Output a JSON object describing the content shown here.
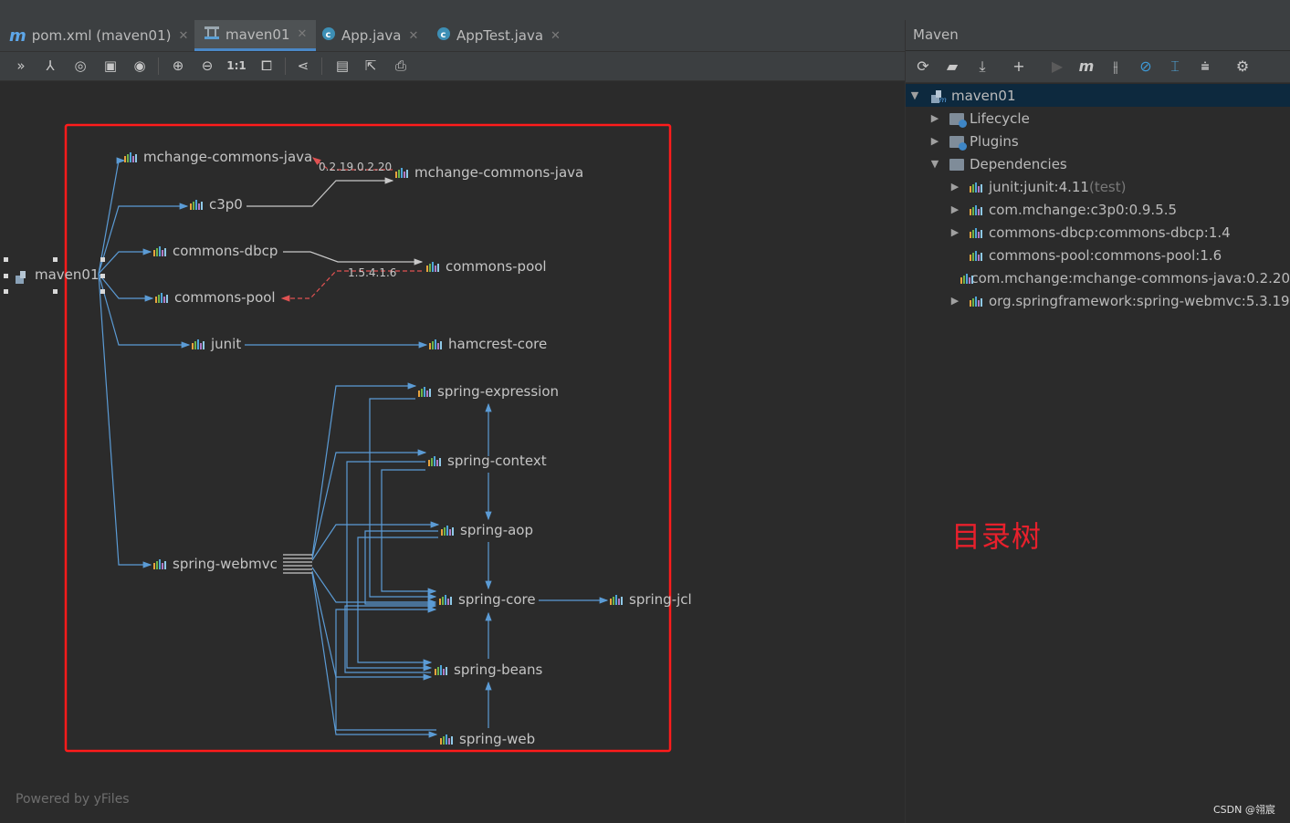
{
  "editor": {
    "tabs": [
      {
        "icon": "m",
        "label": "pom.xml (maven01)",
        "active": false
      },
      {
        "icon": "diagram",
        "label": "maven01",
        "active": true
      },
      {
        "icon": "c",
        "label": "App.java",
        "active": false
      },
      {
        "icon": "c",
        "label": "AppTest.java",
        "active": false
      }
    ],
    "toolbar_icons": [
      "collapse-double-chevron-icon",
      "hierarchy-icon",
      "fit-content-icon",
      "actual-size-icon",
      "eye-icon",
      "zoom-in-icon",
      "zoom-out-icon",
      "one-to-one-icon",
      "fit-page-icon",
      "share-icon",
      "save-icon",
      "export-icon",
      "print-icon"
    ],
    "zoom_one_to_one": "1:1",
    "powered_by": "Powered by yFiles"
  },
  "graph": {
    "root": "maven01",
    "nodes": {
      "mchange_left": "mchange-commons-java",
      "mchange_right": "mchange-commons-java",
      "c3p0": "c3p0",
      "commons_dbcp": "commons-dbcp",
      "commons_pool_right": "commons-pool",
      "commons_pool_left": "commons-pool",
      "junit": "junit",
      "hamcrest_core": "hamcrest-core",
      "spring_expression": "spring-expression",
      "spring_context": "spring-context",
      "spring_aop": "spring-aop",
      "spring_webmvc": "spring-webmvc",
      "spring_core": "spring-core",
      "spring_jcl": "spring-jcl",
      "spring_beans": "spring-beans",
      "spring_web": "spring-web"
    },
    "conflict_labels": {
      "mchange": "0.2.19.0.2.20",
      "commons_pool": "1.5.4.1.6"
    }
  },
  "maven_panel": {
    "title": "Maven",
    "toolbar_icons": [
      "reload-icon",
      "generate-sources-icon",
      "download-icon",
      "add-icon",
      "run-icon",
      "execute-goal-icon",
      "toggle-offline-icon",
      "skip-tests-icon",
      "show-dependencies-icon",
      "collapse-all-icon",
      "settings-wrench-icon"
    ],
    "tree": [
      {
        "level": 0,
        "expanded": true,
        "icon": "project",
        "label": "maven01",
        "suffix": "",
        "selected": true
      },
      {
        "level": 1,
        "expanded": false,
        "icon": "folder-gear",
        "label": "Lifecycle",
        "suffix": ""
      },
      {
        "level": 1,
        "expanded": false,
        "icon": "folder-gear",
        "label": "Plugins",
        "suffix": ""
      },
      {
        "level": 1,
        "expanded": true,
        "icon": "folder-lib",
        "label": "Dependencies",
        "suffix": ""
      },
      {
        "level": 2,
        "expanded": false,
        "icon": "lib",
        "label": "junit:junit:4.11",
        "suffix": " (test)"
      },
      {
        "level": 2,
        "expanded": false,
        "icon": "lib",
        "label": "com.mchange:c3p0:0.9.5.5",
        "suffix": ""
      },
      {
        "level": 2,
        "expanded": false,
        "icon": "lib",
        "label": "commons-dbcp:commons-dbcp:1.4",
        "suffix": ""
      },
      {
        "level": 2,
        "expanded": null,
        "icon": "lib",
        "label": "commons-pool:commons-pool:1.6",
        "suffix": ""
      },
      {
        "level": 2,
        "expanded": null,
        "icon": "lib",
        "label": "com.mchange:mchange-commons-java:0.2.20",
        "suffix": ""
      },
      {
        "level": 2,
        "expanded": false,
        "icon": "lib",
        "label": "org.springframework:spring-webmvc:5.3.19",
        "suffix": ""
      }
    ]
  },
  "annotation": {
    "text": "目录树"
  },
  "watermark": "CSDN @翎宸",
  "colors": {
    "accent": "#4a88c7",
    "edge": "#5b9bd5",
    "conflict": "#e05252",
    "annotation": "#e8202c"
  }
}
